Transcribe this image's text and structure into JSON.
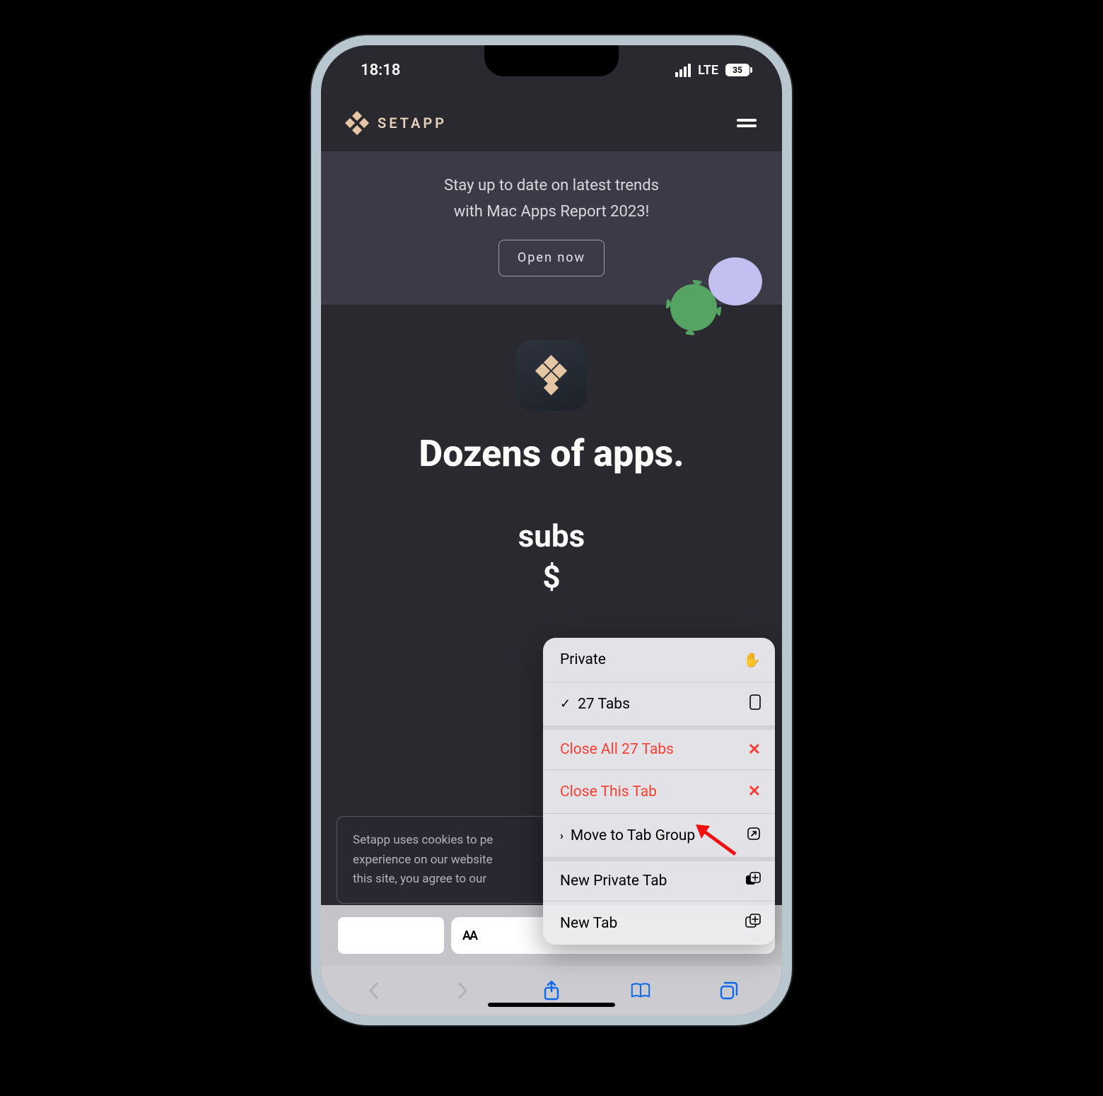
{
  "statusbar": {
    "time": "18:18",
    "network": "LTE",
    "battery": "35"
  },
  "site": {
    "brand": "SETAPP"
  },
  "banner": {
    "line1": "Stay up to date on latest trends",
    "line2": "with Mac Apps Report 2023!",
    "cta": "Open now"
  },
  "hero": {
    "title": "Dozens of apps.",
    "line2": "subs",
    "line3": "$"
  },
  "cookie": {
    "line1": "Setapp uses cookies to pe",
    "line2": "experience on our website",
    "line3": "this site, you agree to our"
  },
  "addressbar": {
    "aa": "AA"
  },
  "menu": {
    "private": "Private",
    "tabs": "27 Tabs",
    "closeAll": "Close All 27 Tabs",
    "closeThis": "Close This Tab",
    "moveGroup": "Move to Tab Group",
    "newPrivate": "New Private Tab",
    "newTab": "New Tab"
  }
}
